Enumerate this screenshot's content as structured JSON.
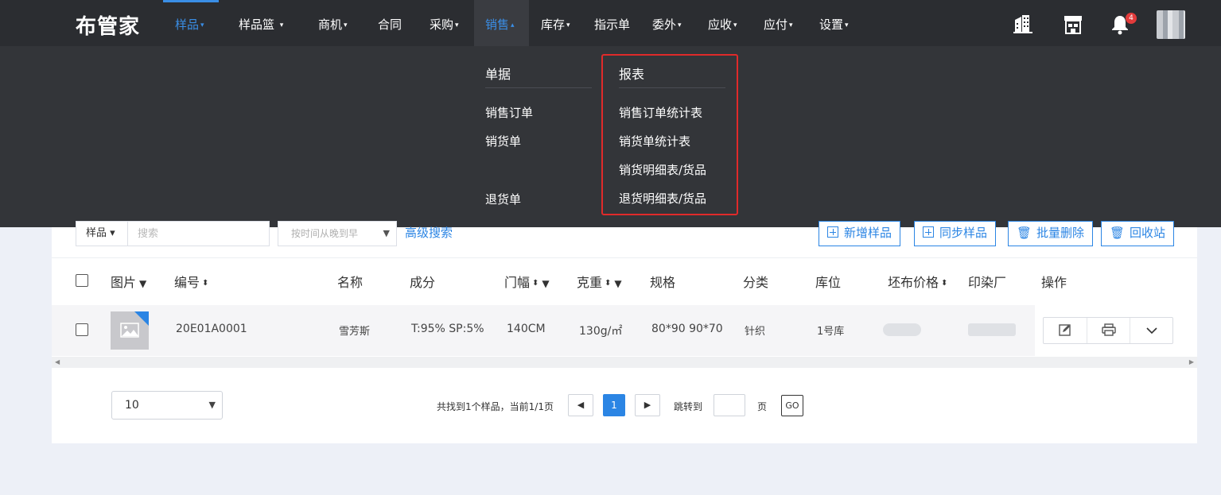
{
  "brand": {
    "logo": "布管家"
  },
  "nav": {
    "items": [
      {
        "label": "样品",
        "caret": "▾"
      },
      {
        "label": "样品篮",
        "caret": "▾"
      },
      {
        "label": "商机",
        "caret": "▾"
      },
      {
        "label": "合同",
        "caret": ""
      },
      {
        "label": "采购",
        "caret": "▾"
      },
      {
        "label": "销售",
        "caret": "▴"
      },
      {
        "label": "库存",
        "caret": "▾"
      },
      {
        "label": "指示单",
        "caret": ""
      },
      {
        "label": "委外",
        "caret": "▾"
      },
      {
        "label": "应收",
        "caret": "▾"
      },
      {
        "label": "应付",
        "caret": "▾"
      },
      {
        "label": "设置",
        "caret": "▾"
      }
    ],
    "notification_count": "4"
  },
  "dropdown": {
    "col1_title": "单据",
    "col1_items": [
      "销售订单",
      "销货单",
      "退货单"
    ],
    "col2_title": "报表",
    "col2_items": [
      "销售订单统计表",
      "销货单统计表",
      "销货明细表/货品",
      "退货明细表/货品"
    ]
  },
  "toolbar": {
    "category": "样品 ▾",
    "search_placeholder": "搜索",
    "sort": "按时间从晚到早",
    "advanced": "高级搜索",
    "buttons": [
      "新增样品",
      "同步样品",
      "批量删除",
      "回收站"
    ]
  },
  "table": {
    "headers": [
      "图片",
      "编号",
      "名称",
      "成分",
      "门幅",
      "克重",
      "规格",
      "分类",
      "库位",
      "坯布价格",
      "印染厂",
      "操作"
    ],
    "rows": [
      {
        "code": "20E01A0001",
        "name": "雪芳斯",
        "composition": "T:95% SP:5%",
        "width": "140CM",
        "weight": "130g/㎡",
        "spec": "80*90 90*70",
        "category": "针织",
        "location": "1号库"
      }
    ]
  },
  "pagination": {
    "page_size": "10",
    "summary": "共找到1个样品，当前1/1页",
    "current_page": "1",
    "jump_label": "跳转到",
    "page_unit": "页",
    "go": "GO"
  }
}
